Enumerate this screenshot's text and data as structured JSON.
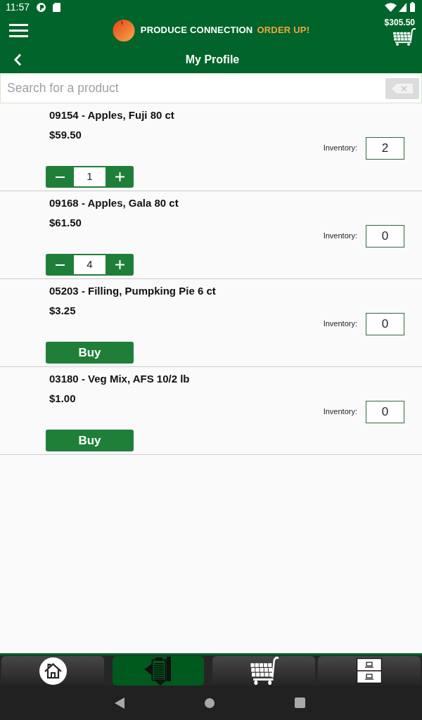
{
  "status_bar": {
    "time": "11:57"
  },
  "header": {
    "brand": "PRODUCE CONNECTION",
    "tagline": "ORDER UP!",
    "cart_total": "$305.50"
  },
  "title_bar": {
    "title": "My Profile"
  },
  "search": {
    "placeholder": "Search for a product"
  },
  "products": [
    {
      "kind": "stepper",
      "name": "09154 - Apples, Fuji 80 ct",
      "price": "$59.50",
      "inventory_label": "Inventory:",
      "inventory": "2",
      "quantity": "1"
    },
    {
      "kind": "stepper",
      "name": "09168 - Apples, Gala 80 ct",
      "price": "$61.50",
      "inventory_label": "Inventory:",
      "inventory": "0",
      "quantity": "4"
    },
    {
      "kind": "buy",
      "name": "05203 - Filling, Pumpking Pie 6 ct",
      "price": "$3.25",
      "inventory_label": "Inventory:",
      "inventory": "0",
      "button": "Buy"
    },
    {
      "kind": "buy",
      "name": "03180 - Veg Mix, AFS 10/2 lb",
      "price": "$1.00",
      "inventory_label": "Inventory:",
      "inventory": "0",
      "button": "Buy"
    }
  ],
  "bottom_nav": [
    {
      "kind": "home",
      "selected": false
    },
    {
      "kind": "orders",
      "selected": true
    },
    {
      "kind": "cart",
      "selected": false
    },
    {
      "kind": "cabinet",
      "selected": false
    }
  ]
}
